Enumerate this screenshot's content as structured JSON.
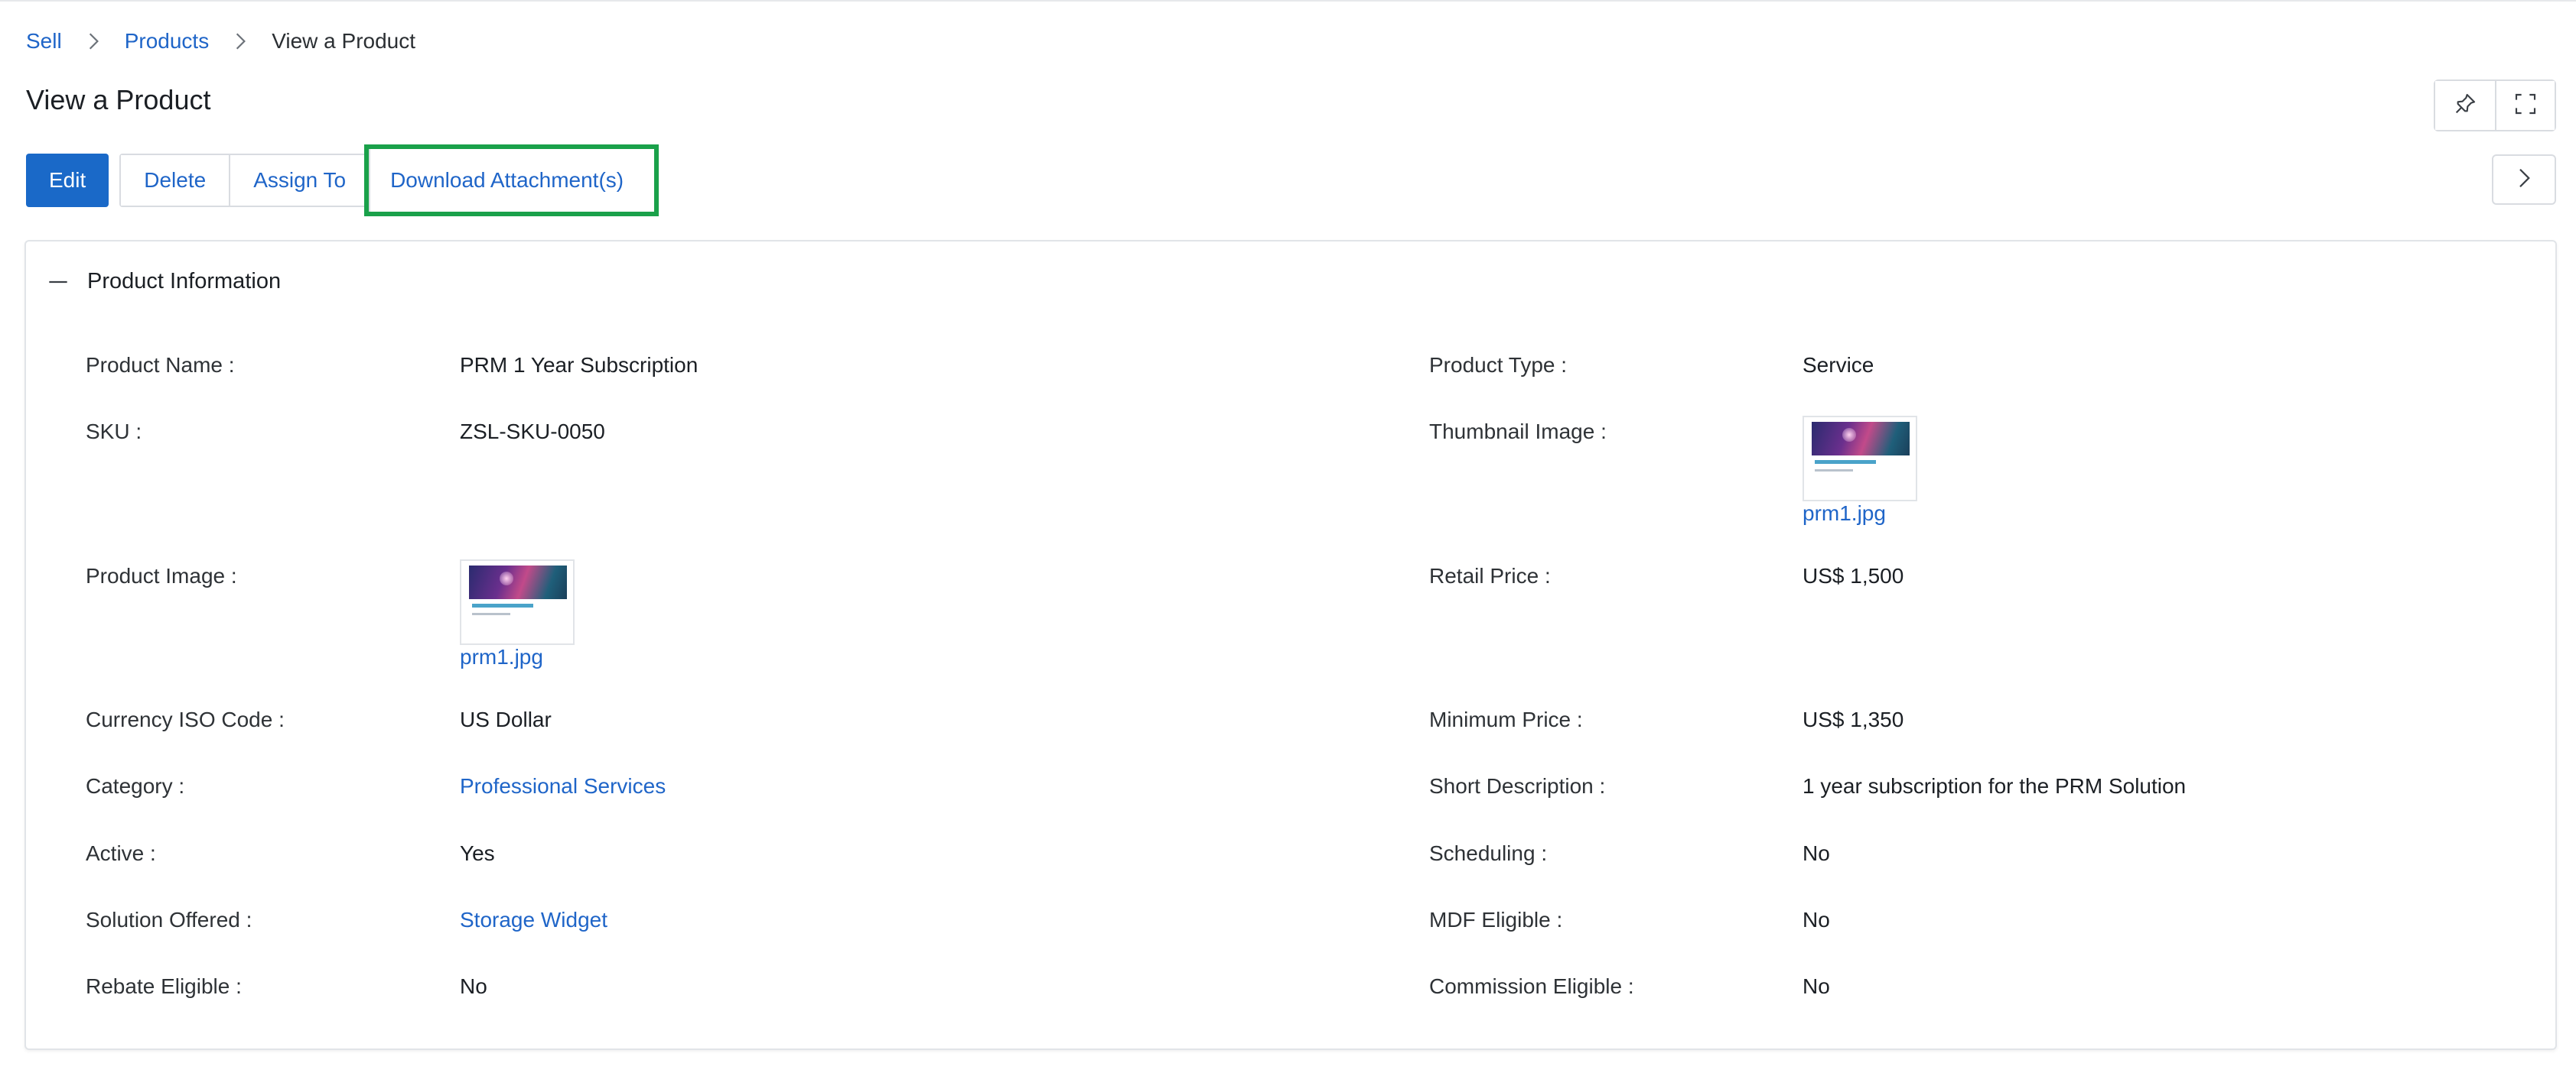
{
  "breadcrumb": {
    "items": [
      {
        "label": "Sell"
      },
      {
        "label": "Products"
      },
      {
        "label": "View a Product"
      }
    ]
  },
  "page": {
    "title": "View a Product"
  },
  "toolbar": {
    "edit_label": "Edit",
    "delete_label": "Delete",
    "assign_label": "Assign To",
    "download_label": "Download Attachment(s)"
  },
  "section": {
    "title": "Product Information"
  },
  "fields": {
    "product_name": {
      "label": "Product Name :",
      "value": "PRM 1 Year Subscription"
    },
    "product_type": {
      "label": "Product Type :",
      "value": "Service"
    },
    "sku": {
      "label": "SKU :",
      "value": "ZSL-SKU-0050"
    },
    "thumbnail_image": {
      "label": "Thumbnail Image :",
      "value": "prm1.jpg"
    },
    "product_image": {
      "label": "Product Image :",
      "value": "prm1.jpg"
    },
    "retail_price": {
      "label": "Retail Price :",
      "value": "US$ 1,500"
    },
    "currency": {
      "label": "Currency ISO Code :",
      "value": "US Dollar"
    },
    "minimum_price": {
      "label": "Minimum Price :",
      "value": "US$ 1,350"
    },
    "category": {
      "label": "Category :",
      "value": "Professional Services"
    },
    "short_description": {
      "label": "Short Description :",
      "value": "1 year subscription for the PRM Solution"
    },
    "active": {
      "label": "Active :",
      "value": "Yes"
    },
    "scheduling": {
      "label": "Scheduling :",
      "value": "No"
    },
    "solution_offered": {
      "label": "Solution Offered :",
      "value": "Storage Widget"
    },
    "mdf_eligible": {
      "label": "MDF Eligible :",
      "value": "No"
    },
    "rebate_eligible": {
      "label": "Rebate Eligible :",
      "value": "No"
    },
    "commission_eligible": {
      "label": "Commission Eligible :",
      "value": "No"
    }
  },
  "icons": {
    "pin": "pin-icon",
    "expand": "fullscreen-icon",
    "next": "chevron-right-icon",
    "collapse": "minus-icon",
    "breadcrumb_separator": "chevron-right-icon"
  },
  "colors": {
    "primary": "#1a69c8",
    "link": "#1f65c8",
    "highlight": "#1aa14a"
  }
}
